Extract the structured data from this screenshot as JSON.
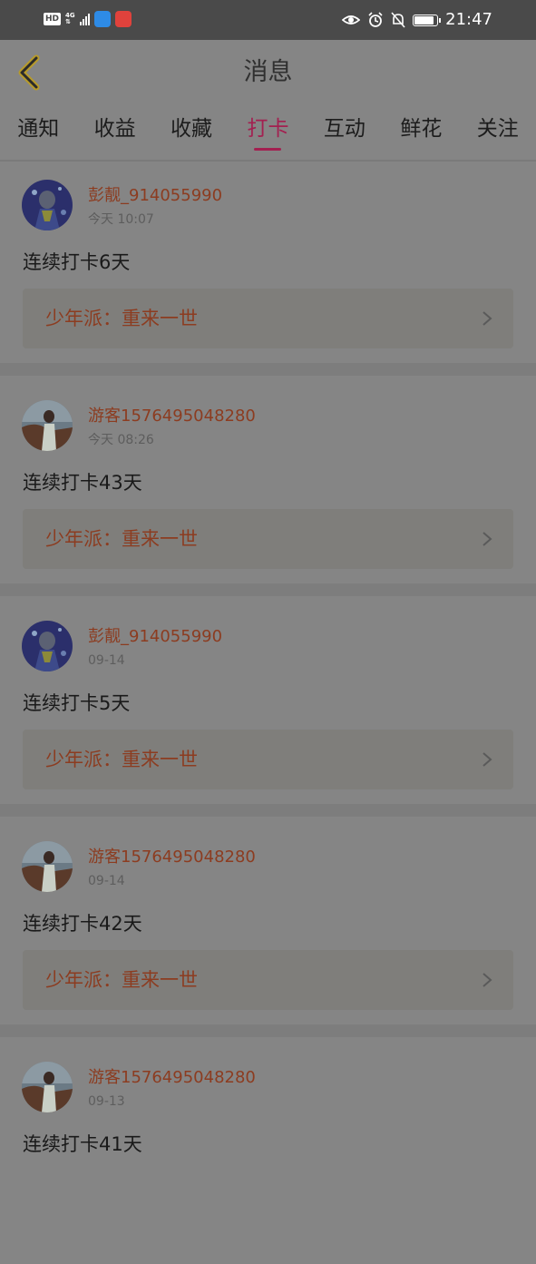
{
  "status_bar": {
    "hd": "HD",
    "network": "4G",
    "time": "21:47"
  },
  "header": {
    "title": "消息"
  },
  "tabs": [
    {
      "label": "通知"
    },
    {
      "label": "收益"
    },
    {
      "label": "收藏"
    },
    {
      "label": "打卡",
      "active": true
    },
    {
      "label": "互动"
    },
    {
      "label": "鲜花"
    },
    {
      "label": "关注"
    }
  ],
  "messages": [
    {
      "user": "彭靓_914055990",
      "time": "今天 10:07",
      "content": "连续打卡6天",
      "book": "少年派：重来一世"
    },
    {
      "user": "游客1576495048280",
      "time": "今天 08:26",
      "content": "连续打卡43天",
      "book": "少年派：重来一世"
    },
    {
      "user": "彭靓_914055990",
      "time": "09-14",
      "content": "连续打卡5天",
      "book": "少年派：重来一世"
    },
    {
      "user": "游客1576495048280",
      "time": "09-14",
      "content": "连续打卡42天",
      "book": "少年派：重来一世"
    },
    {
      "user": "游客1576495048280",
      "time": "09-13",
      "content": "连续打卡41天"
    }
  ],
  "colors": {
    "accent": "#a32050",
    "username": "#8c3c20",
    "overlay_bg": "#858585"
  }
}
